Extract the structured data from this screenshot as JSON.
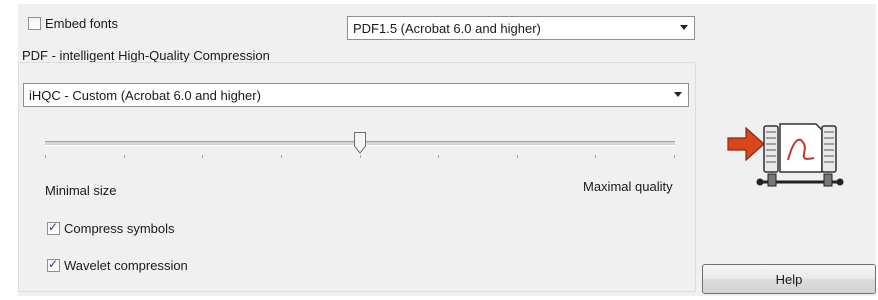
{
  "embed_fonts": {
    "label": "Embed fonts",
    "checked": false
  },
  "pdf_version": {
    "selected": "PDF1.5 (Acrobat 6.0 and higher)"
  },
  "compression_group": {
    "title": "PDF - intelligent High-Quality Compression",
    "preset": {
      "selected": "iHQC - Custom (Acrobat 6.0 and higher)"
    },
    "slider": {
      "min_label": "Minimal size",
      "max_label": "Maximal quality",
      "tick_count": 9,
      "value_fraction": 0.5
    },
    "compress_symbols": {
      "label": "Compress symbols",
      "checked": true
    },
    "wavelet_compression": {
      "label": "Wavelet compression",
      "checked": true
    }
  },
  "help_button": {
    "label": "Help"
  },
  "illustration": {
    "icon": "pdf-compression-press-icon",
    "colors": {
      "arrow": "#d9461b",
      "paper_mark": "#c0392b"
    }
  }
}
